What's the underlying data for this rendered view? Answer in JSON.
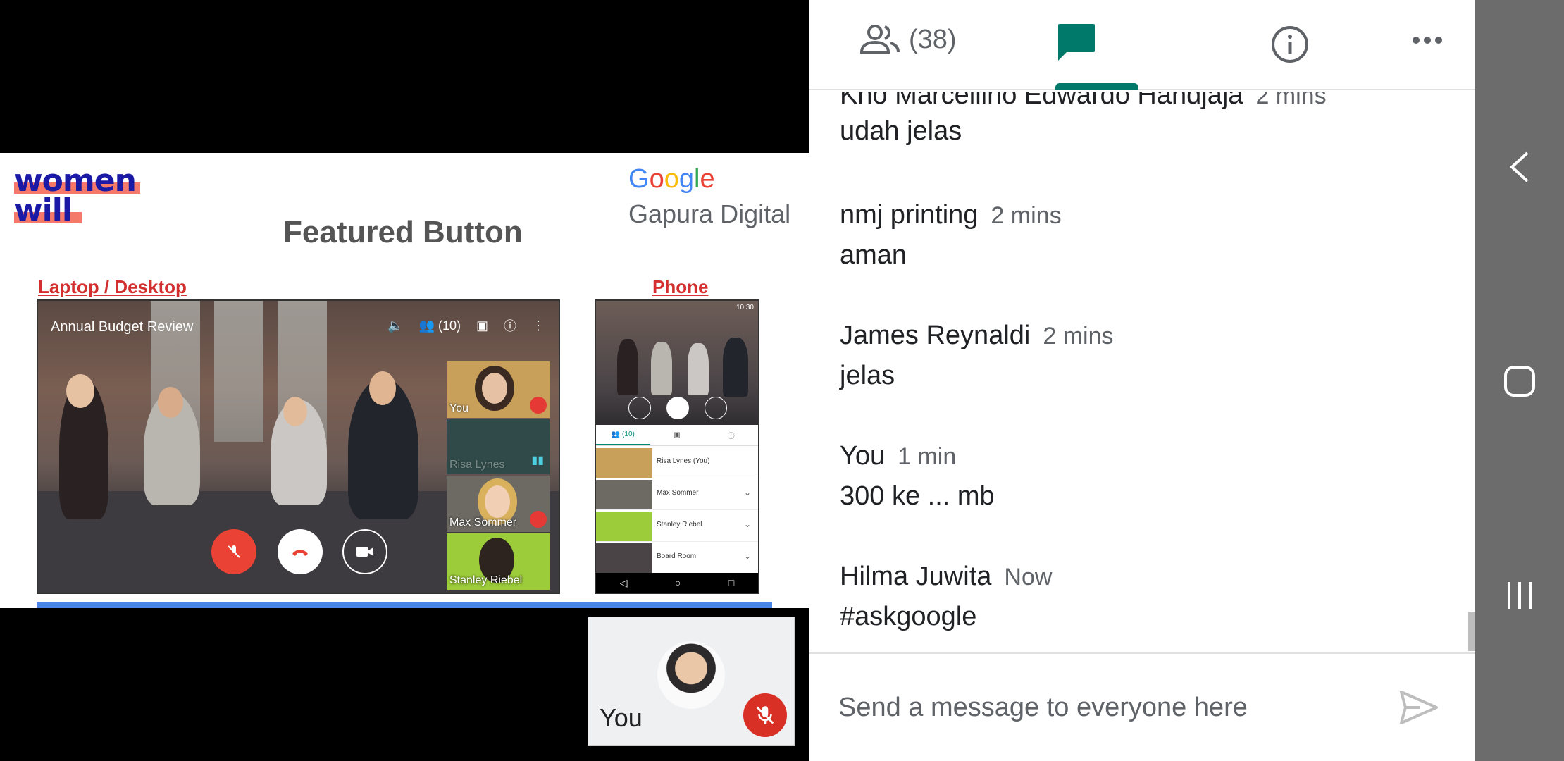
{
  "slide": {
    "logo_line1": "women",
    "logo_line2": "will",
    "google_letters": [
      {
        "ch": "G",
        "color": "#4285F4"
      },
      {
        "ch": "o",
        "color": "#EA4335"
      },
      {
        "ch": "o",
        "color": "#FBBC05"
      },
      {
        "ch": "g",
        "color": "#4285F4"
      },
      {
        "ch": "l",
        "color": "#34A853"
      },
      {
        "ch": "e",
        "color": "#EA4335"
      }
    ],
    "subtitle": "Gapura Digital",
    "title": "Featured Button",
    "label_laptop": "Laptop / Desktop",
    "label_phone": "Phone",
    "laptop": {
      "meeting_title": "Annual Budget Review",
      "participant_count": "(10)",
      "tiles": [
        "You",
        "Risa Lynes",
        "Max Sommer",
        "Stanley Riebel"
      ]
    },
    "phone": {
      "status_time": "10:30",
      "tab_people": "(10)",
      "rows": [
        "Risa Lynes (You)",
        "Max Sommer",
        "Stanley Riebel",
        "Board Room"
      ]
    }
  },
  "self_view": {
    "label": "You"
  },
  "chat": {
    "header": {
      "participant_count": "(38)"
    },
    "messages": [
      {
        "sender": "Kho Marcellino Edwardo Handjaja",
        "time": "2 mins",
        "text": "udah jelas"
      },
      {
        "sender": "nmj printing",
        "time": "2 mins",
        "text": "aman"
      },
      {
        "sender": "James Reynaldi",
        "time": "2 mins",
        "text": "jelas"
      },
      {
        "sender": "You",
        "time": "1 min",
        "text": "300 ke ... mb"
      },
      {
        "sender": "Hilma Juwita",
        "time": "Now",
        "text": "#askgoogle"
      }
    ],
    "composer": {
      "placeholder": "Send a message to everyone here",
      "value": ""
    }
  },
  "colors": {
    "accent": "#00796b",
    "mute_red": "#d93025",
    "slide_label_red": "#d32f2f",
    "nav_bar": "#6c6c6c"
  },
  "icons": [
    "people-icon",
    "chat-icon",
    "info-icon",
    "more-icon",
    "send-icon",
    "mic-off-icon",
    "back-icon",
    "home-icon",
    "recents-icon"
  ]
}
